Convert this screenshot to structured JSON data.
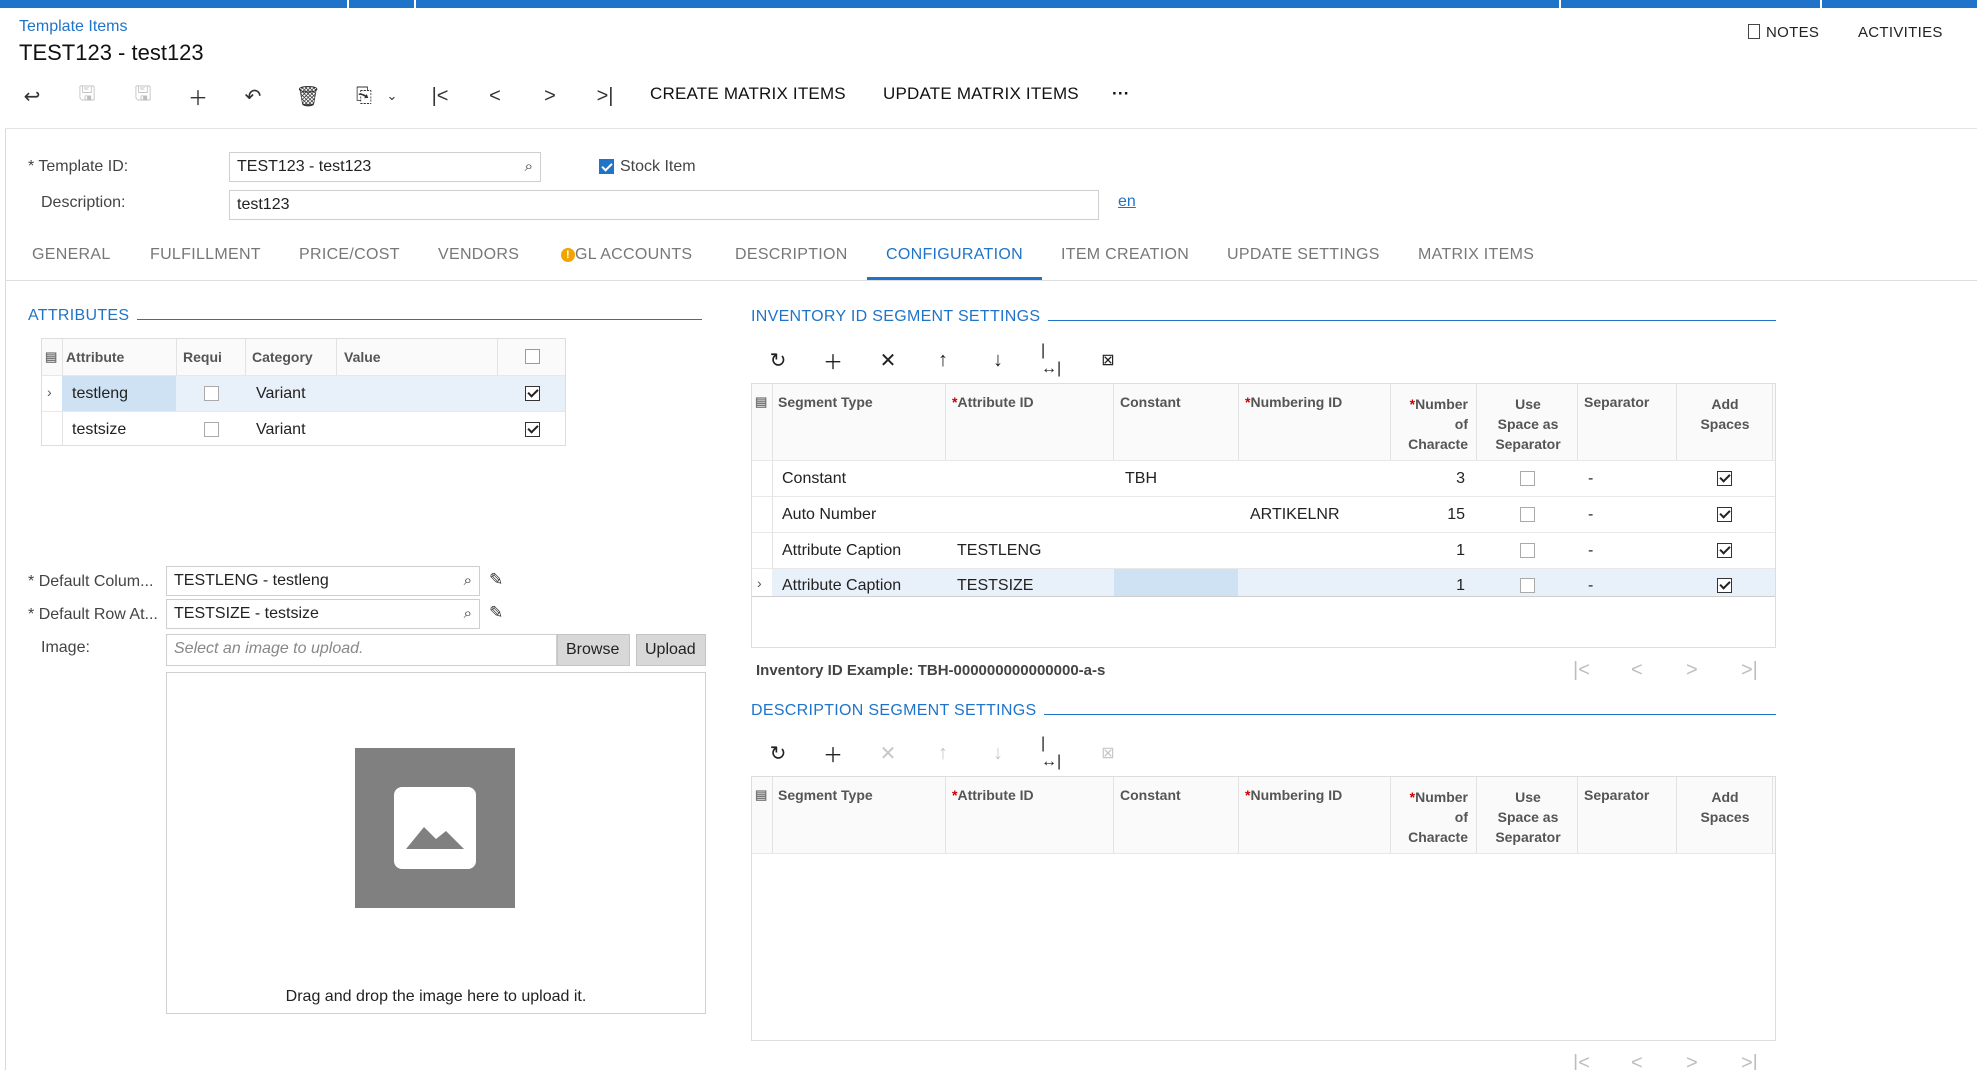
{
  "header": {
    "breadcrumb": "Template Items",
    "title": "TEST123 - test123",
    "notes_label": "NOTES",
    "activities_label": "ACTIVITIES"
  },
  "toolbar": {
    "create_matrix_label": "CREATE MATRIX ITEMS",
    "update_matrix_label": "UPDATE MATRIX ITEMS",
    "more_label": "···"
  },
  "form": {
    "template_id_label": "Template ID:",
    "template_id_value": "TEST123 - test123",
    "stock_item_label": "Stock Item",
    "stock_item_checked": true,
    "description_label": "Description:",
    "description_value": "test123",
    "lang_link": "en",
    "required_mark": "*"
  },
  "tabs": [
    {
      "label": "GENERAL"
    },
    {
      "label": "FULFILLMENT"
    },
    {
      "label": "PRICE/COST"
    },
    {
      "label": "VENDORS"
    },
    {
      "label": "GL ACCOUNTS",
      "warning": true
    },
    {
      "label": "DESCRIPTION"
    },
    {
      "label": "CONFIGURATION",
      "active": true
    },
    {
      "label": "ITEM CREATION"
    },
    {
      "label": "UPDATE SETTINGS"
    },
    {
      "label": "MATRIX ITEMS"
    }
  ],
  "attributes": {
    "title": "ATTRIBUTES",
    "columns": [
      "Attribute",
      "Requi",
      "Category",
      "Value"
    ],
    "rows": [
      {
        "attribute": "testleng",
        "category": "Variant",
        "selected": true,
        "checked": true
      },
      {
        "attribute": "testsize",
        "category": "Variant",
        "selected": false,
        "checked": true
      }
    ]
  },
  "defaults": {
    "col_label": "Default Colum...",
    "col_value": "TESTLENG - testleng",
    "row_label": "Default Row At...",
    "row_value": "TESTSIZE - testsize",
    "image_label": "Image:",
    "image_placeholder": "Select an image to upload.",
    "browse_label": "Browse",
    "upload_label": "Upload",
    "drop_text": "Drag and drop the image here to upload it."
  },
  "inventory_segments": {
    "title": "INVENTORY ID SEGMENT SETTINGS",
    "columns": {
      "segment_type": "Segment Type",
      "attribute_id": "Attribute ID",
      "constant": "Constant",
      "numbering_id": "Numbering ID",
      "number_l1": "Number",
      "number_l2": "of",
      "number_l3": "Characte",
      "use_space_l1": "Use",
      "use_space_l2": "Space as",
      "use_space_l3": "Separator",
      "separator": "Separator",
      "add_spaces_l1": "Add",
      "add_spaces_l2": "Spaces"
    },
    "rows": [
      {
        "segment_type": "Constant",
        "attribute_id": "",
        "constant": "TBH",
        "numbering_id": "",
        "number": "3",
        "separator": "-",
        "add_spaces": true
      },
      {
        "segment_type": "Auto Number",
        "attribute_id": "",
        "constant": "",
        "numbering_id": "ARTIKELNR",
        "number": "15",
        "separator": "-",
        "add_spaces": true
      },
      {
        "segment_type": "Attribute Caption",
        "attribute_id": "TESTLENG",
        "constant": "",
        "numbering_id": "",
        "number": "1",
        "separator": "-",
        "add_spaces": true
      },
      {
        "segment_type": "Attribute Caption",
        "attribute_id": "TESTSIZE",
        "constant": "",
        "numbering_id": "",
        "number": "1",
        "separator": "-",
        "add_spaces": true,
        "selected": true
      }
    ],
    "example": "Inventory ID Example: TBH-000000000000000-a-s"
  },
  "description_segments": {
    "title": "DESCRIPTION SEGMENT SETTINGS"
  },
  "colors": {
    "accent": "#1f74c9",
    "selected_row": "#e8f1fa"
  }
}
